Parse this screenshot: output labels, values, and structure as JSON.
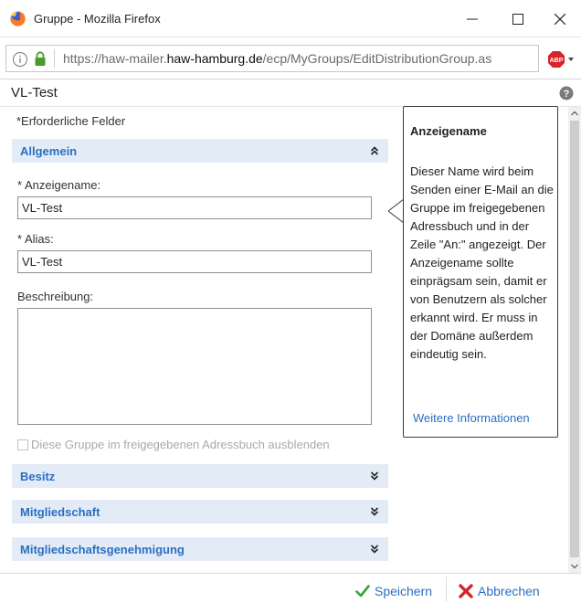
{
  "window": {
    "title": "Gruppe - Mozilla Firefox",
    "minimize_glyph": "—",
    "maximize_glyph": "☐",
    "close_glyph": "✕"
  },
  "urlbar": {
    "url_prefix": "https://haw-mailer.",
    "url_domain": "haw-hamburg.de",
    "url_path": "/ecp/MyGroups/EditDistributionGroup.as"
  },
  "page": {
    "title": "VL-Test",
    "required_note": "*Erforderliche Felder"
  },
  "sections": {
    "general": {
      "label": "Allgemein",
      "icon": "double-chevron-up-icon"
    },
    "ownership": {
      "label": "Besitz",
      "icon": "double-chevron-down-icon"
    },
    "membership": {
      "label": "Mitgliedschaft",
      "icon": "double-chevron-down-icon"
    },
    "membership_approval": {
      "label": "Mitgliedschaftsgenehmigung",
      "icon": "double-chevron-down-icon"
    }
  },
  "form": {
    "display_name_label": "* Anzeigename:",
    "display_name_value": "VL-Test",
    "alias_label": "* Alias:",
    "alias_value": "VL-Test",
    "description_label": "Beschreibung:",
    "description_value": "",
    "hide_checkbox_label": "Diese Gruppe im freigegebenen Adressbuch ausblenden",
    "hide_checkbox_checked": false
  },
  "help_callout": {
    "title": "Anzeigename",
    "body": "Dieser Name wird beim Senden einer E-Mail an die Gruppe im freigegebenen Adressbuch und in der Zeile \"An:\" angezeigt. Der Anzeigename sollte einprägsam sein, damit er von Benutzern als solcher erkannt wird. Er muss in der Domäne außerdem eindeutig sein.",
    "link": "Weitere Informationen"
  },
  "footer": {
    "save_label": "Speichern",
    "cancel_label": "Abbrechen"
  },
  "colors": {
    "accent": "#2a6fc2",
    "section_bg": "#e3ecf6",
    "save_icon": "#3aa33a",
    "cancel_icon": "#d0272c"
  }
}
